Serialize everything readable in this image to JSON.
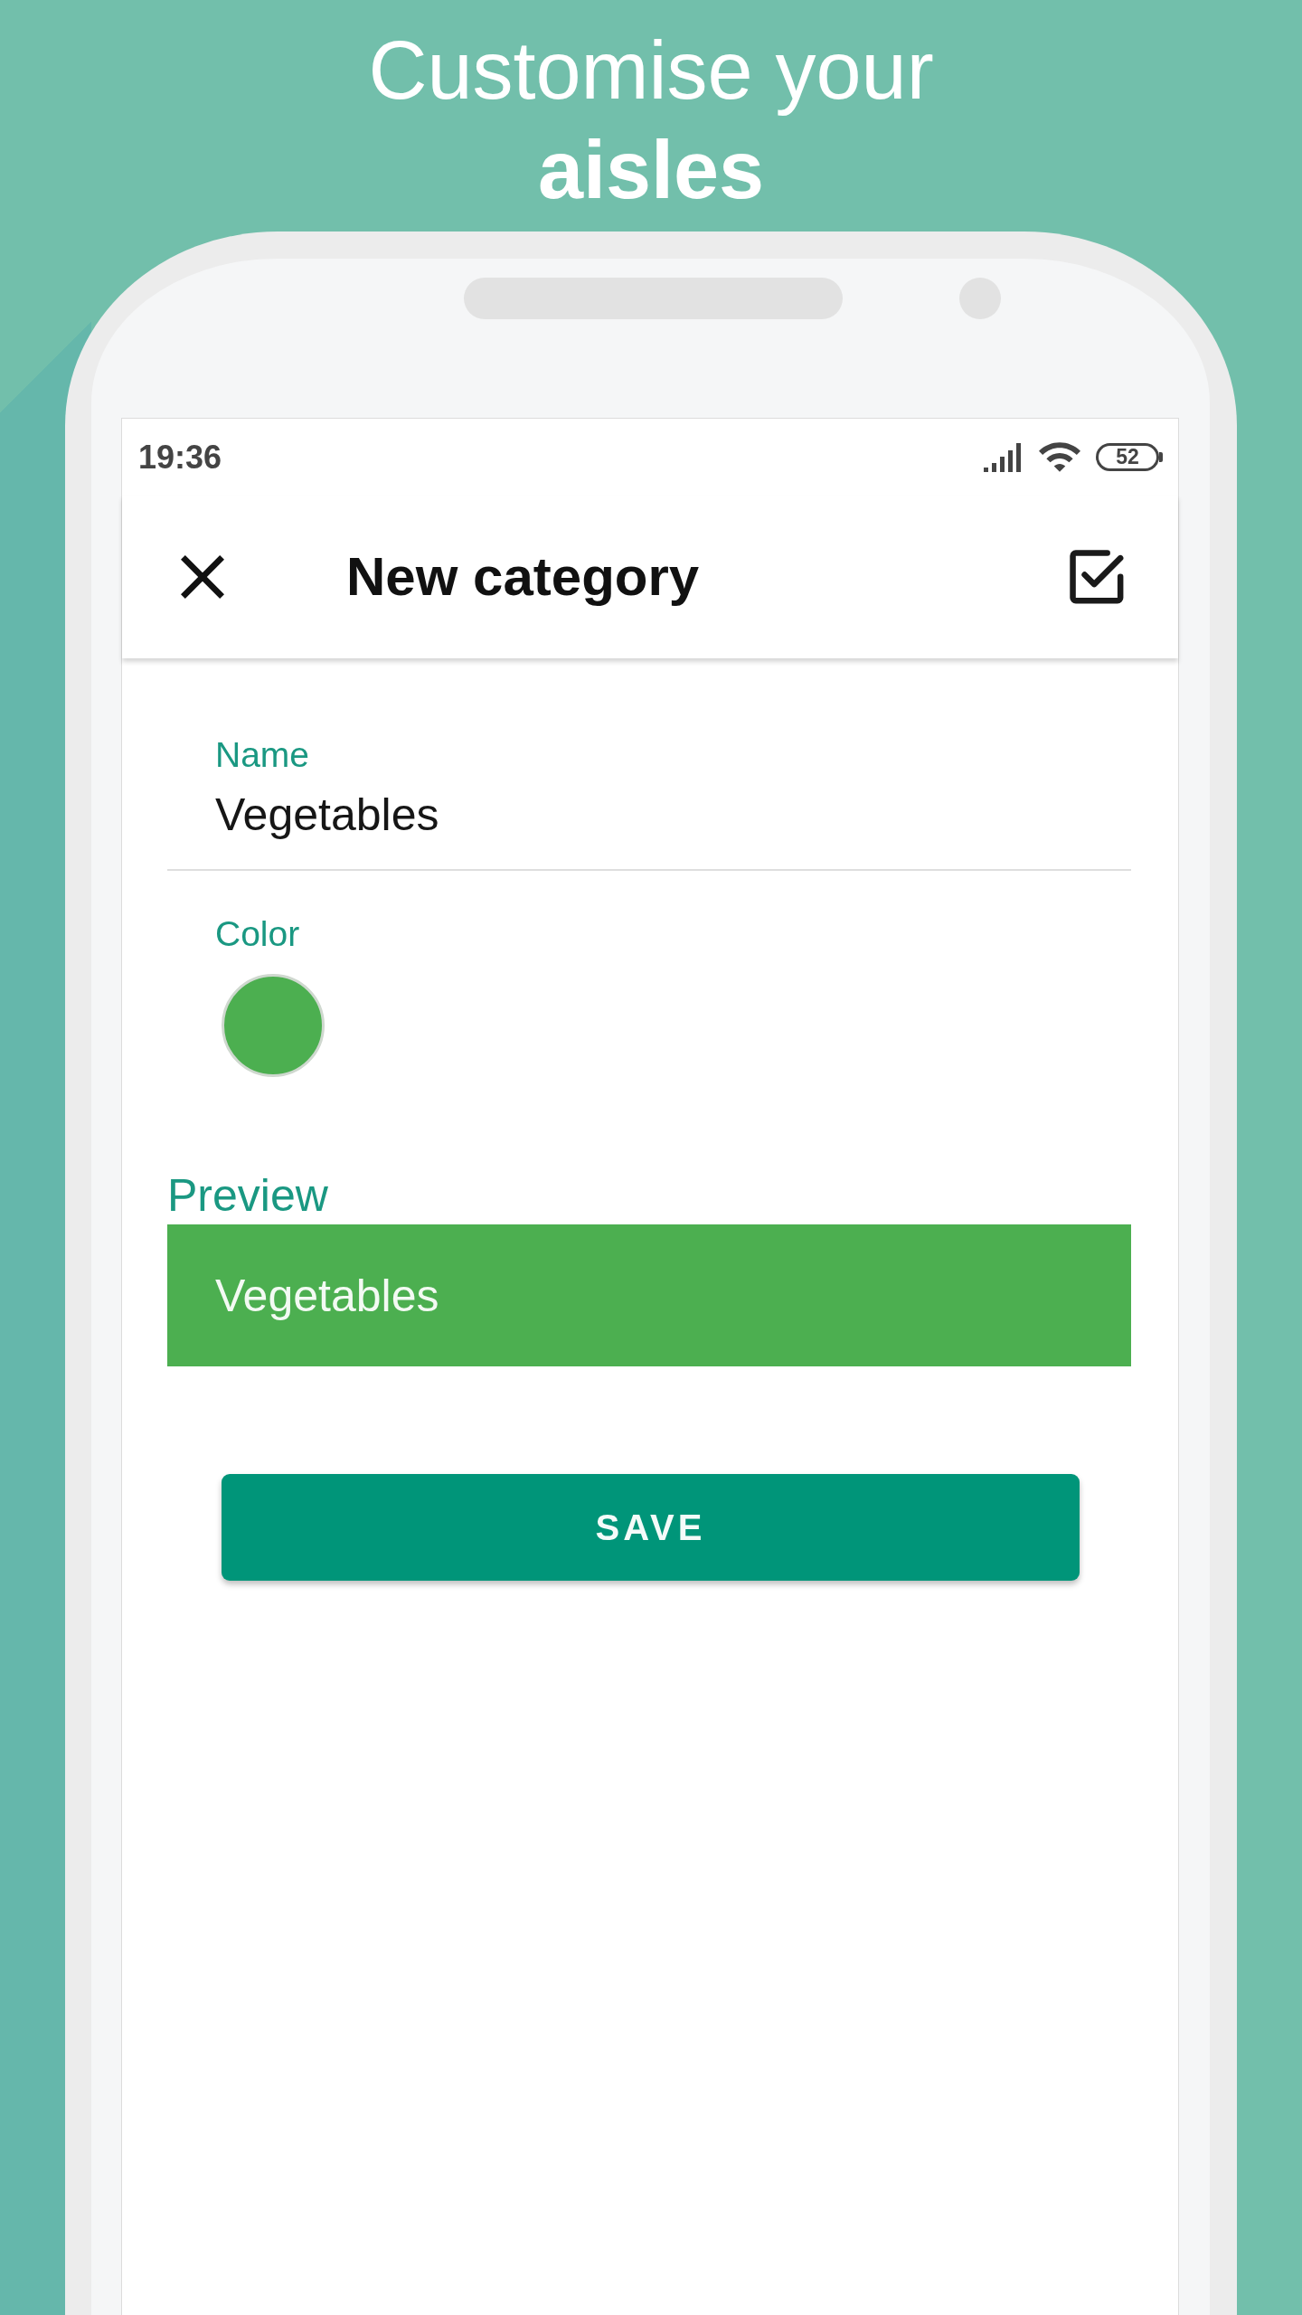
{
  "headline": {
    "text": "Customise your **aisles**"
  },
  "status_bar": {
    "time": "19:36",
    "battery": "52"
  },
  "app_bar": {
    "title": "New category"
  },
  "form": {
    "name_field": {
      "label": "Name",
      "value": "Vegetables"
    },
    "color_field": {
      "label": "Color",
      "color": "#4caf50"
    }
  },
  "preview": {
    "label": "Preview",
    "text": "Vegetables"
  },
  "save_button": {
    "label": "SAVE"
  }
}
